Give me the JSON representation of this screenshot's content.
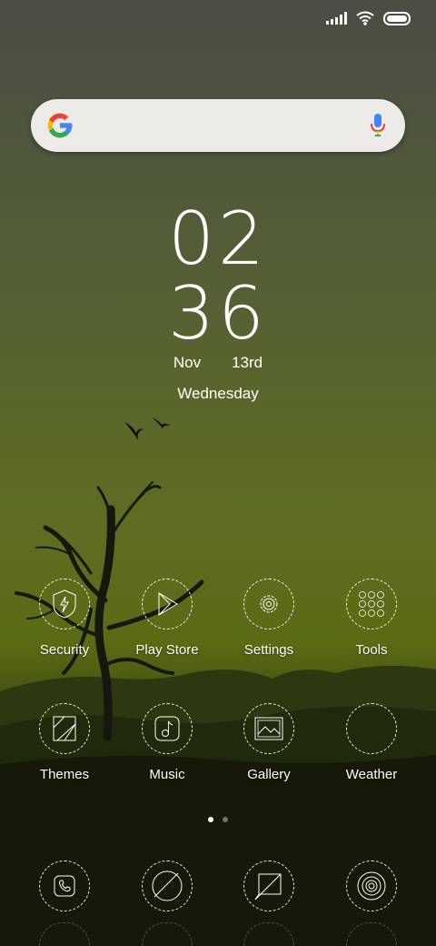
{
  "clock": {
    "hour": "02",
    "minute": "36",
    "month": "Nov",
    "date": "13rd",
    "weekday": "Wednesday"
  },
  "apps_row1": [
    {
      "label": "Security"
    },
    {
      "label": "Play Store"
    },
    {
      "label": "Settings"
    },
    {
      "label": "Tools"
    }
  ],
  "apps_row2": [
    {
      "label": "Themes"
    },
    {
      "label": "Music"
    },
    {
      "label": "Gallery"
    },
    {
      "label": "Weather"
    }
  ],
  "page_indicator": {
    "pages": 2,
    "current": 1
  },
  "dock": [
    {
      "icon": "phone-icon"
    },
    {
      "icon": "browser-icon"
    },
    {
      "icon": "messages-icon"
    },
    {
      "icon": "camera-icon"
    }
  ],
  "colors": {
    "google_blue": "#4285F4",
    "google_red": "#EA4335",
    "google_yellow": "#FBBC05",
    "google_green": "#34A853"
  }
}
